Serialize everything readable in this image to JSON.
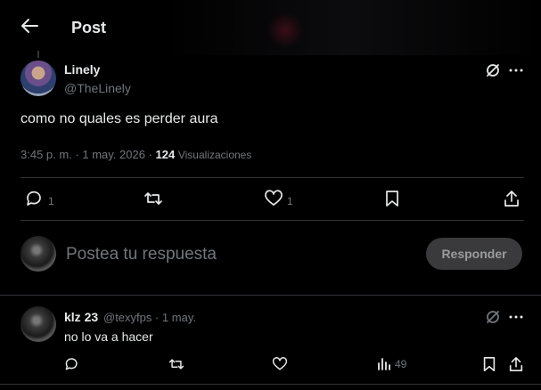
{
  "header": {
    "title": "Post"
  },
  "post": {
    "author_name": "Linely",
    "author_handle": "@TheLinely",
    "text": "como no quales es perder aura",
    "timestamp": "3:45 p. m. · 1 may. 2026 ·",
    "views_count": "124",
    "views_label": "Visualizaciones",
    "replies": "1",
    "likes": "1",
    "avatar_icon": "avatar-linely"
  },
  "composer": {
    "placeholder": "Postea tu respuesta",
    "button_label": "Responder"
  },
  "reply": {
    "author_name": "klz 23",
    "author_handle": "@texyfps · 1 may.",
    "text": "no lo va a hacer",
    "views": "49"
  },
  "icons": [
    "back-arrow-icon",
    "grok-icon",
    "more-icon",
    "reply-icon",
    "repost-icon",
    "like-icon",
    "bookmark-icon",
    "share-icon",
    "views-icon"
  ],
  "colors": {
    "background": "#000000",
    "text": "#e7e9ea",
    "muted": "#71767b",
    "divider": "#2f3336",
    "button_bg": "#3a3a3c"
  }
}
